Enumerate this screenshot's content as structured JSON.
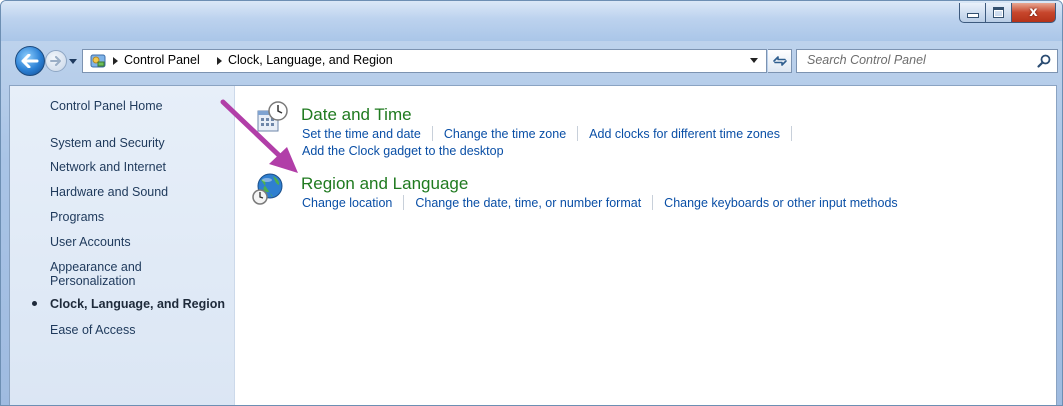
{
  "window": {
    "close_glyph": "x"
  },
  "navigation": {
    "breadcrumbs": [
      "Control Panel",
      "Clock, Language, and Region"
    ],
    "search_placeholder": "Search Control Panel"
  },
  "sidebar": {
    "home": "Control Panel Home",
    "items": [
      "System and Security",
      "Network and Internet",
      "Hardware and Sound",
      "Programs",
      "User Accounts",
      "Appearance and",
      "Personalization",
      "Clock, Language, and Region",
      "Ease of Access"
    ]
  },
  "categories": [
    {
      "title": "Date and Time",
      "icon": "clock-calendar-icon",
      "tasks_line1": [
        "Set the time and date",
        "Change the time zone",
        "Add clocks for different time zones"
      ],
      "tasks_line2": [
        "Add the Clock gadget to the desktop"
      ]
    },
    {
      "title": "Region and Language",
      "icon": "globe-clock-icon",
      "tasks_line1": [
        "Change location",
        "Change the date, time, or number format",
        "Change keyboards or other input methods"
      ]
    }
  ],
  "colors": {
    "category_title": "#1f7a1f",
    "task_link": "#0a4fa6",
    "annotation_arrow": "#b13ea8"
  }
}
